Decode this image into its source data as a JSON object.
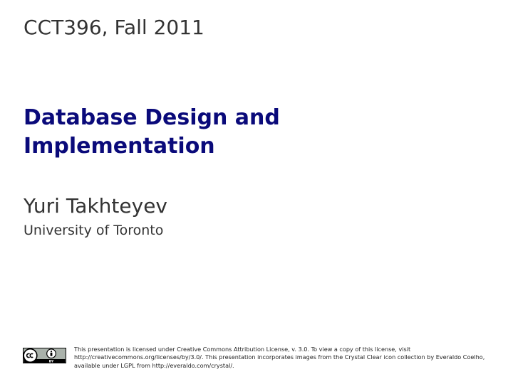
{
  "slide": {
    "course": "CCT396, Fall 2011",
    "title_lines": [
      "Database Design and",
      "Implementation"
    ],
    "author": "Yuri Takhteyev",
    "affiliation": "University of Toronto",
    "license_badge": {
      "icons": [
        "cc-icon",
        "attribution-icon"
      ],
      "label": "BY"
    },
    "license_text": "This presentation is licensed under Creative Commons Attribution License, v. 3.0. To view a copy of this license, visit http://creativecommons.org/licenses/by/3.0/. This presentation incorporates images from the Crystal Clear icon collection by Everaldo Coelho, available under LGPL from http://everaldo.com/crystal/."
  }
}
